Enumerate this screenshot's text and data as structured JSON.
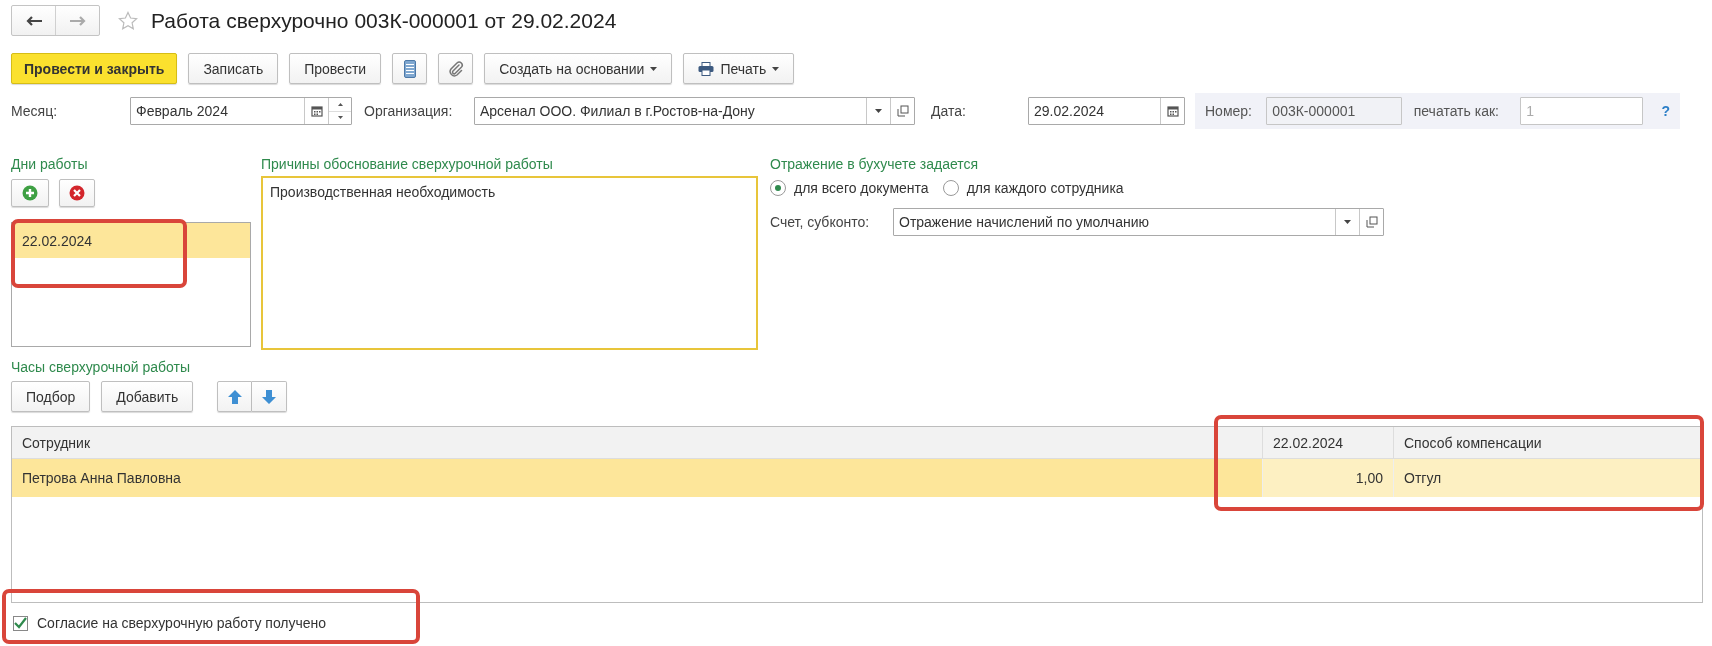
{
  "title": "Работа сверхурочно 003К-000001 от 29.02.2024",
  "toolbar": [
    {
      "kind": "primary",
      "label": "Провести и закрыть"
    },
    {
      "kind": "plain",
      "label": "Записать"
    },
    {
      "kind": "plain",
      "label": "Провести"
    },
    {
      "kind": "journal"
    },
    {
      "kind": "attach"
    },
    {
      "kind": "menu",
      "label": "Создать на основании"
    },
    {
      "kind": "print",
      "label": "Печать"
    }
  ],
  "month": {
    "label": "Месяц:",
    "value": "Февраль 2024"
  },
  "organization": {
    "label": "Организация:",
    "value": "Арсенал ООО. Филиал в г.Ростов-на-Дону"
  },
  "date": {
    "label": "Дата:",
    "value": "29.02.2024"
  },
  "number": {
    "label": "Номер:",
    "value": "003К-000001"
  },
  "print_as": {
    "label": "печатать как:",
    "placeholder": "1",
    "help": "?"
  },
  "work_days": {
    "label": "Дни работы",
    "rows": [
      {
        "value": "22.02.2024",
        "selected": true
      }
    ]
  },
  "reasons": {
    "label": "Причины обоснование сверхурочной работы",
    "value": "Производственная необходимость"
  },
  "accounting": {
    "label": "Отражение в бухучете задается",
    "options": [
      {
        "label": "для всего документа",
        "selected": true
      },
      {
        "label": "для каждого сотрудника",
        "selected": false
      }
    ],
    "account": {
      "label": "Счет, субконто:",
      "value": "Отражение начислений по умолчанию"
    }
  },
  "hours": {
    "label": "Часы сверхурочной работы",
    "buttons": [
      "Подбор",
      "Добавить"
    ],
    "table": {
      "columns": [
        "Сотрудник",
        "22.02.2024",
        "Способ компенсации"
      ],
      "rows": [
        {
          "cells": [
            "Петрова Анна Павловна",
            "1,00",
            "Отгул"
          ],
          "selected": true
        }
      ]
    }
  },
  "consent": {
    "label": "Согласие на сверхурочную работу получено",
    "checked": true
  }
}
